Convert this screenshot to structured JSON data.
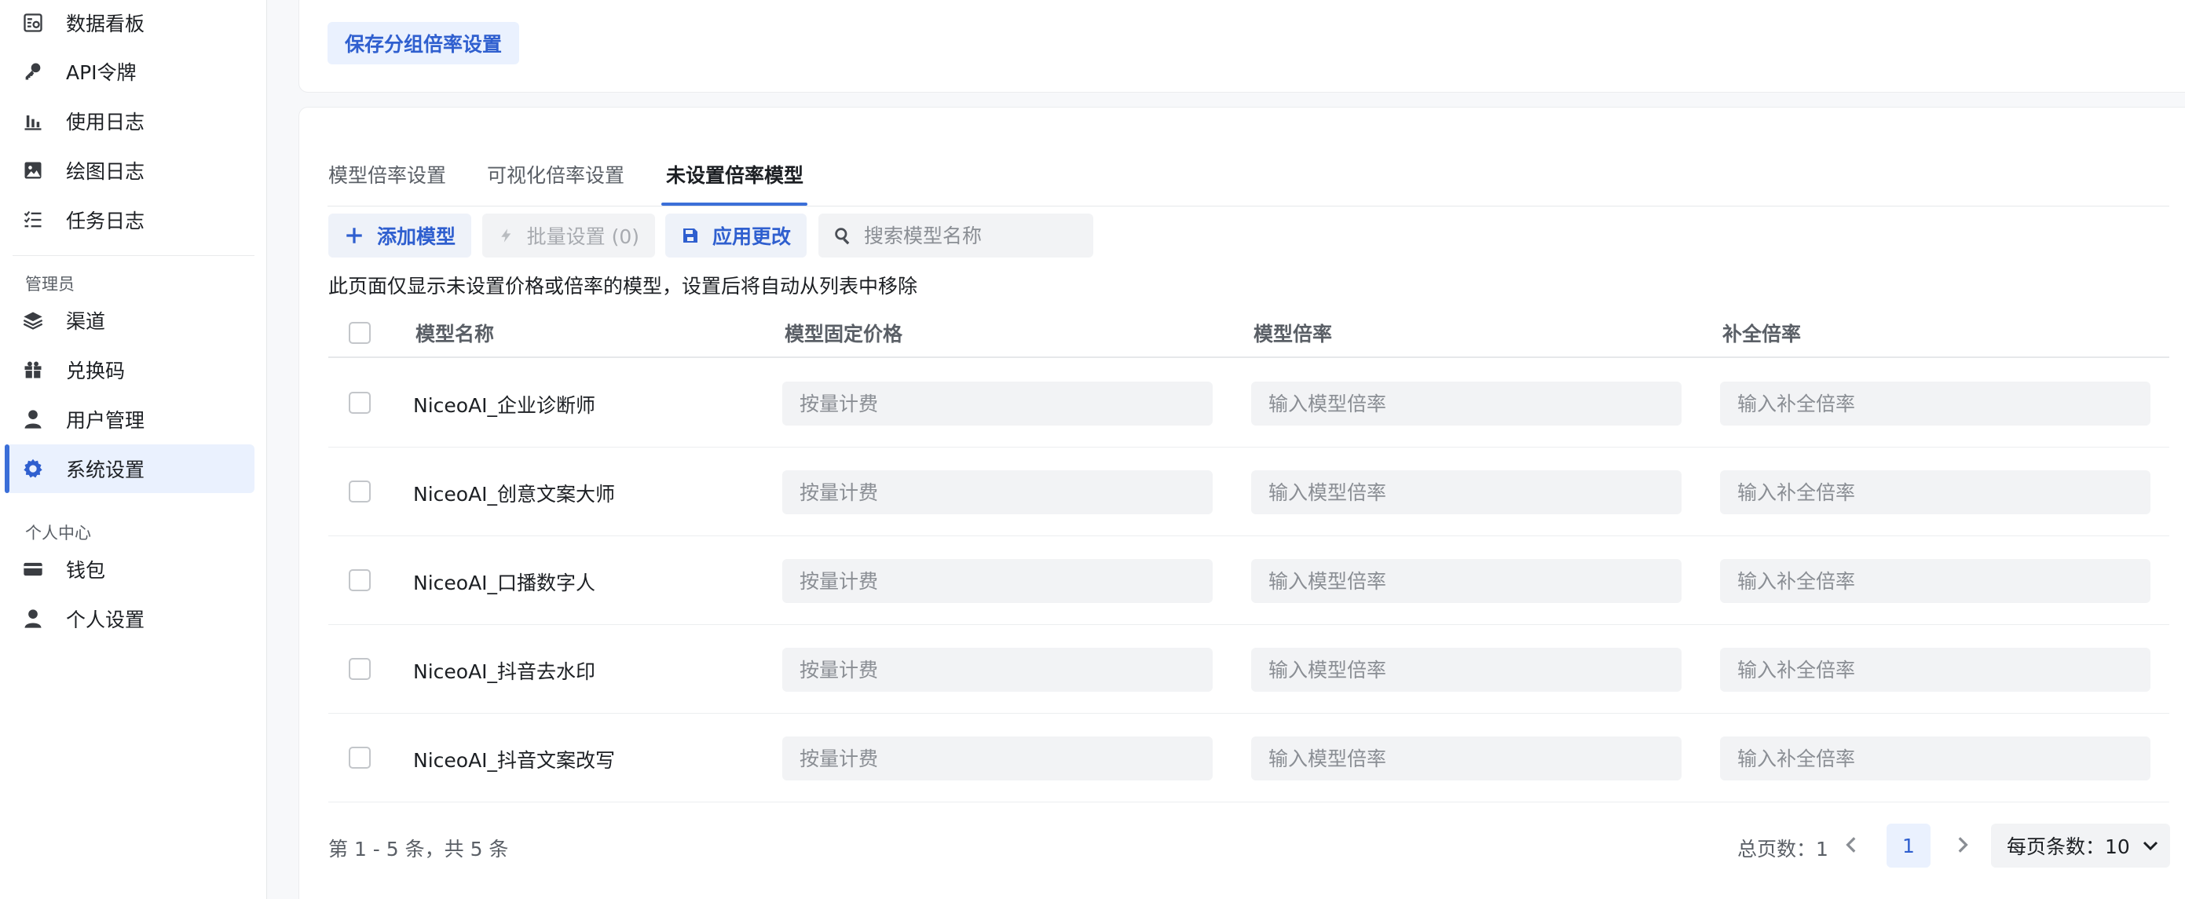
{
  "sidebar": {
    "items": [
      {
        "label": "数据看板",
        "icon": "dashboard-icon"
      },
      {
        "label": "API令牌",
        "icon": "key-icon"
      },
      {
        "label": "使用日志",
        "icon": "bar-chart-icon"
      },
      {
        "label": "绘图日志",
        "icon": "image-icon"
      },
      {
        "label": "任务日志",
        "icon": "checklist-icon"
      }
    ],
    "admin_title": "管理员",
    "admin_items": [
      {
        "label": "渠道",
        "icon": "layers-icon"
      },
      {
        "label": "兑换码",
        "icon": "gift-icon"
      },
      {
        "label": "用户管理",
        "icon": "user-icon"
      },
      {
        "label": "系统设置",
        "icon": "gear-icon",
        "active": true
      }
    ],
    "personal_title": "个人中心",
    "personal_items": [
      {
        "label": "钱包",
        "icon": "wallet-icon"
      },
      {
        "label": "个人设置",
        "icon": "user-icon"
      }
    ]
  },
  "main": {
    "save_group_label": "保存分组倍率设置",
    "tabs": [
      {
        "label": "模型倍率设置"
      },
      {
        "label": "可视化倍率设置"
      },
      {
        "label": "未设置倍率模型",
        "active": true
      }
    ],
    "toolbar": {
      "add_label": "添加模型",
      "batch_label": "批量设置 (0)",
      "apply_label": "应用更改",
      "search_placeholder": "搜索模型名称"
    },
    "notice": "此页面仅显示未设置价格或倍率的模型，设置后将自动从列表中移除",
    "columns": [
      "模型名称",
      "模型固定价格",
      "模型倍率",
      "补全倍率"
    ],
    "rows": [
      {
        "name": "NiceoAI_企业诊断师",
        "price_placeholder": "按量计费",
        "ratio_placeholder": "输入模型倍率",
        "complete_placeholder": "输入补全倍率"
      },
      {
        "name": "NiceoAI_创意文案大师",
        "price_placeholder": "按量计费",
        "ratio_placeholder": "输入模型倍率",
        "complete_placeholder": "输入补全倍率"
      },
      {
        "name": "NiceoAI_口播数字人",
        "price_placeholder": "按量计费",
        "ratio_placeholder": "输入模型倍率",
        "complete_placeholder": "输入补全倍率"
      },
      {
        "name": "NiceoAI_抖音去水印",
        "price_placeholder": "按量计费",
        "ratio_placeholder": "输入模型倍率",
        "complete_placeholder": "输入补全倍率"
      },
      {
        "name": "NiceoAI_抖音文案改写",
        "price_placeholder": "按量计费",
        "ratio_placeholder": "输入模型倍率",
        "complete_placeholder": "输入补全倍率"
      }
    ],
    "footer_info": "第 1 - 5 条，共 5 条",
    "pagination": {
      "total_pages_label": "总页数：1",
      "current_page": "1",
      "page_size_label": "每页条数：10"
    },
    "colors": {
      "accent": "#3b6fd8",
      "accent_bg": "#eaf1fe"
    }
  }
}
